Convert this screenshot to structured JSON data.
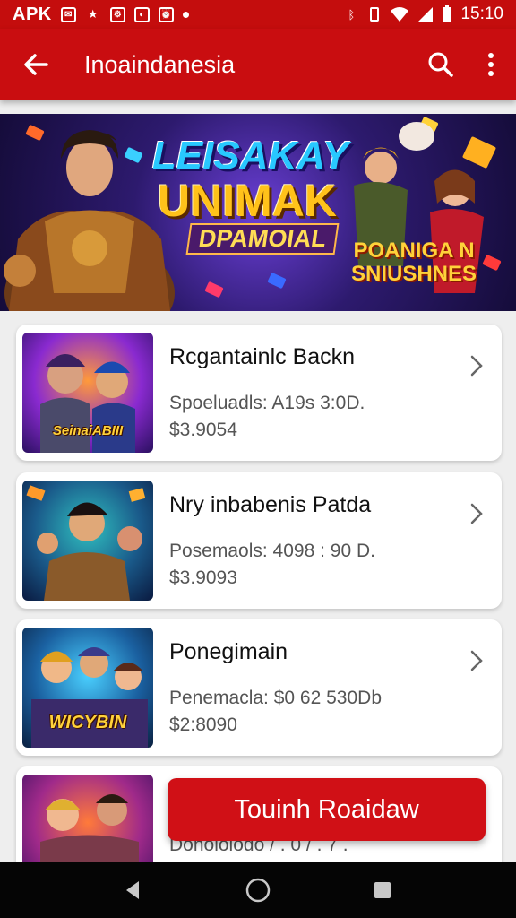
{
  "status_bar": {
    "carrier": "APK",
    "time": "15:10"
  },
  "app_bar": {
    "title": "Inoaindanesia"
  },
  "banner": {
    "line1": "LEISAKAY",
    "line2": "UNIMAK",
    "line3": "DPAMOIAL",
    "line4a": "POANIGA N",
    "line4b": "SNIUSHNES"
  },
  "items": [
    {
      "title": "Rcgantainlc Backn",
      "subtitle": "Spoeluadls: A19s 3:0D.",
      "price": "$3.9054",
      "thumb_label": "SeinaiABIII"
    },
    {
      "title": "Nry inbabenis Patda",
      "subtitle": "Posemaols: 4098 : 90 D.",
      "price": "$3.9093",
      "thumb_label": ""
    },
    {
      "title": "Ponegimain",
      "subtitle": "Penemacla: $0 62 530Db",
      "price": "$2:8090",
      "thumb_label": "WICYBIN"
    },
    {
      "title": "",
      "subtitle": "Donololodo  / . 0 / . 7 .",
      "price": "",
      "thumb_label": ""
    }
  ],
  "cta": {
    "label": "Touinh Roaidaw"
  },
  "colors": {
    "primary": "#c90d10",
    "cta": "#d01016"
  },
  "icons": [
    "back-arrow-icon",
    "search-icon",
    "more-vert-icon",
    "chevron-right-icon",
    "nav-back-icon",
    "nav-home-icon",
    "nav-recents-icon"
  ]
}
